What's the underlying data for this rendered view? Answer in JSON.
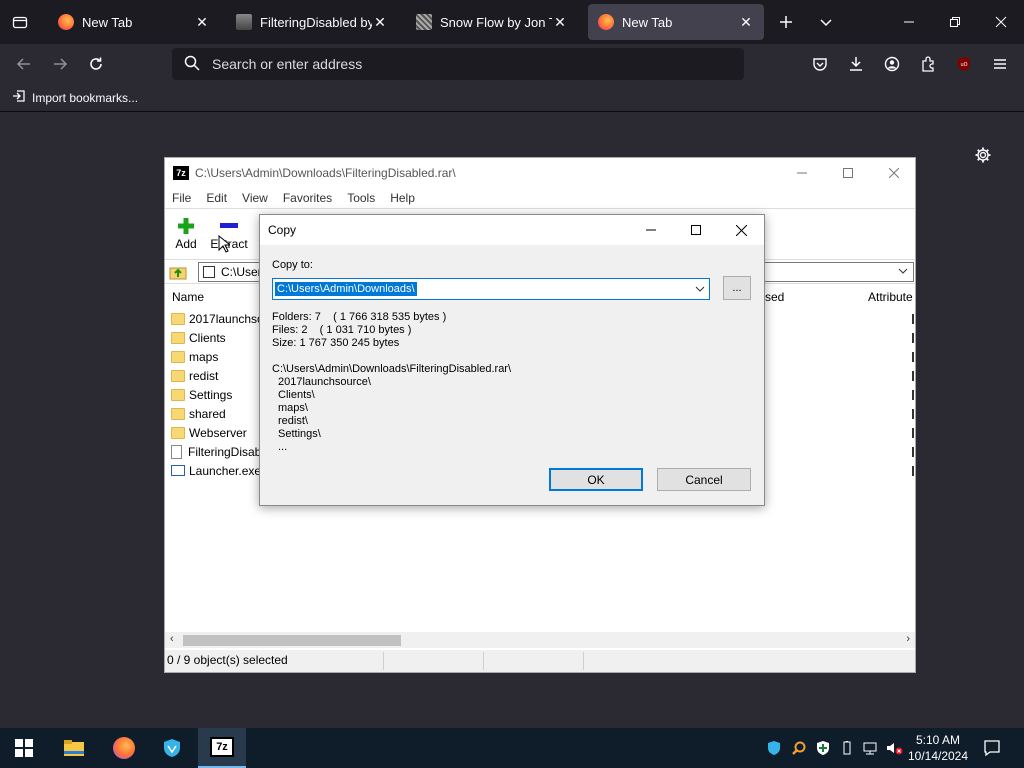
{
  "browser": {
    "tabs": [
      {
        "title": "New Tab",
        "active": false
      },
      {
        "title": "FilteringDisabled by bro",
        "active": false
      },
      {
        "title": "Snow Flow by Jon Topp",
        "active": false
      },
      {
        "title": "New Tab",
        "active": true
      }
    ],
    "url_placeholder": "Search or enter address",
    "bookmarks_label": "Import bookmarks..."
  },
  "zip": {
    "title": "C:\\Users\\Admin\\Downloads\\FilteringDisabled.rar\\",
    "menu": [
      "File",
      "Edit",
      "View",
      "Favorites",
      "Tools",
      "Help"
    ],
    "toolbar": {
      "add": "Add",
      "extract": "Extract"
    },
    "path": "C:\\User",
    "columns": {
      "name": "Name",
      "used": "sed",
      "attributes": "Attribute"
    },
    "files": [
      {
        "name": "2017launchso",
        "type": "folder"
      },
      {
        "name": "Clients",
        "type": "folder"
      },
      {
        "name": "maps",
        "type": "folder"
      },
      {
        "name": "redist",
        "type": "folder"
      },
      {
        "name": "Settings",
        "type": "folder"
      },
      {
        "name": "shared",
        "type": "folder"
      },
      {
        "name": "Webserver",
        "type": "folder"
      },
      {
        "name": "FilteringDisab",
        "type": "doc"
      },
      {
        "name": "Launcher.exe",
        "type": "exe"
      }
    ],
    "status": "0 / 9 object(s) selected"
  },
  "dialog": {
    "title": "Copy",
    "copy_to_label": "Copy to:",
    "copy_to_value": "C:\\Users\\Admin\\Downloads\\",
    "browse_label": "...",
    "folders": "Folders: 7    ( 1 766 318 535 bytes )",
    "files": "Files: 2    ( 1 031 710 bytes )",
    "size": "Size: 1 767 350 245 bytes",
    "source": "C:\\Users\\Admin\\Downloads\\FilteringDisabled.rar\\",
    "items": [
      "2017launchsource\\",
      "Clients\\",
      "maps\\",
      "redist\\",
      "Settings\\",
      "..."
    ],
    "ok": "OK",
    "cancel": "Cancel"
  },
  "taskbar": {
    "time": "5:10 AM",
    "date": "10/14/2024",
    "active_app": "7-Zip",
    "zip_icon_text": "7z"
  },
  "colors": {
    "accent": "#0078d7",
    "browser_bg": "#2b2a33",
    "taskbar": "#0f1c2a"
  }
}
